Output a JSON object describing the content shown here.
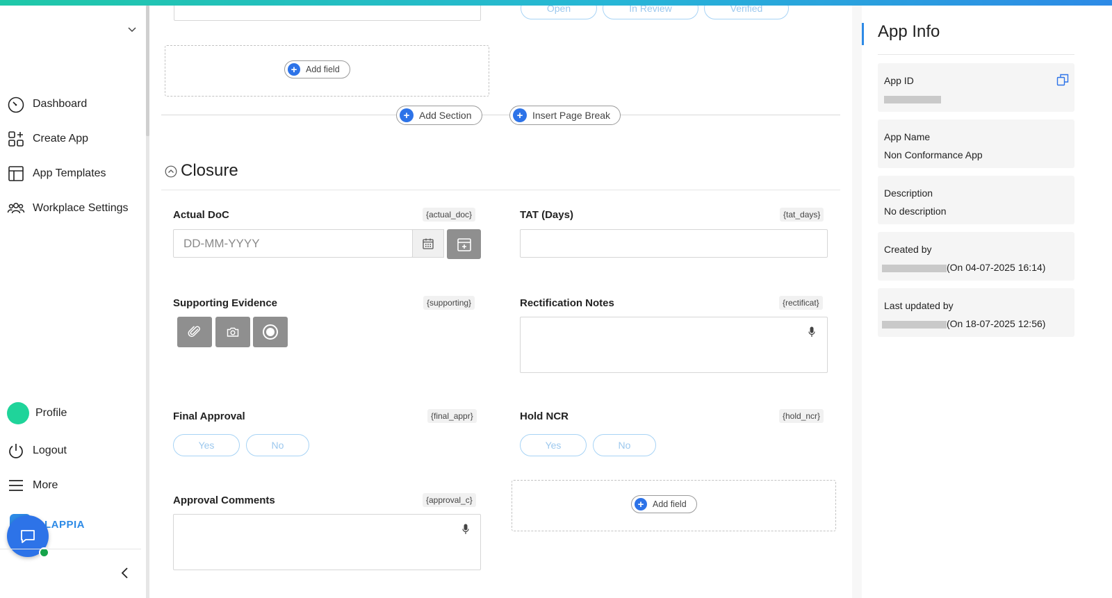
{
  "sidebar": {
    "items": [
      {
        "label": "Dashboard",
        "icon": "dashboard-gauge-icon"
      },
      {
        "label": "Create App",
        "icon": "create-app-grid-icon"
      },
      {
        "label": "App Templates",
        "icon": "templates-layout-icon"
      },
      {
        "label": "Workplace Settings",
        "icon": "people-group-icon"
      }
    ],
    "bottom": [
      {
        "label": "Profile"
      },
      {
        "label": "Logout"
      },
      {
        "label": "More"
      }
    ],
    "brand": "LAPPIA"
  },
  "builder": {
    "top_choices": [
      "Open",
      "In Review",
      "Verified"
    ],
    "add_field": "Add field",
    "add_section": "Add Section",
    "insert_page_break": "Insert Page Break",
    "section_title": "Closure",
    "fields": {
      "actual_doc": {
        "label": "Actual DoC",
        "tag": "{actual_doc}",
        "placeholder": "DD-MM-YYYY"
      },
      "tat_days": {
        "label": "TAT (Days)",
        "tag": "{tat_days}"
      },
      "supporting": {
        "label": "Supporting Evidence",
        "tag": "{supporting}"
      },
      "rectification": {
        "label": "Rectification Notes",
        "tag": "{rectificat}"
      },
      "final_approval": {
        "label": "Final Approval",
        "tag": "{final_appr}",
        "yes": "Yes",
        "no": "No"
      },
      "hold_ncr": {
        "label": "Hold NCR",
        "tag": "{hold_ncr}",
        "yes": "Yes",
        "no": "No"
      },
      "approval_comments": {
        "label": "Approval Comments",
        "tag": "{approval_c}"
      }
    }
  },
  "app_info": {
    "title": "App Info",
    "app_id_label": "App ID",
    "app_name_label": "App Name",
    "app_name": "Non Conformance App",
    "description_label": "Description",
    "description": "No description",
    "created_by_label": "Created by",
    "created_on": "(On 04-07-2025 16:14)",
    "updated_by_label": "Last updated by",
    "updated_on": "(On 18-07-2025 12:56)"
  },
  "colors": {
    "accent": "#2d73e8",
    "brand_green": "#1fd49a"
  }
}
